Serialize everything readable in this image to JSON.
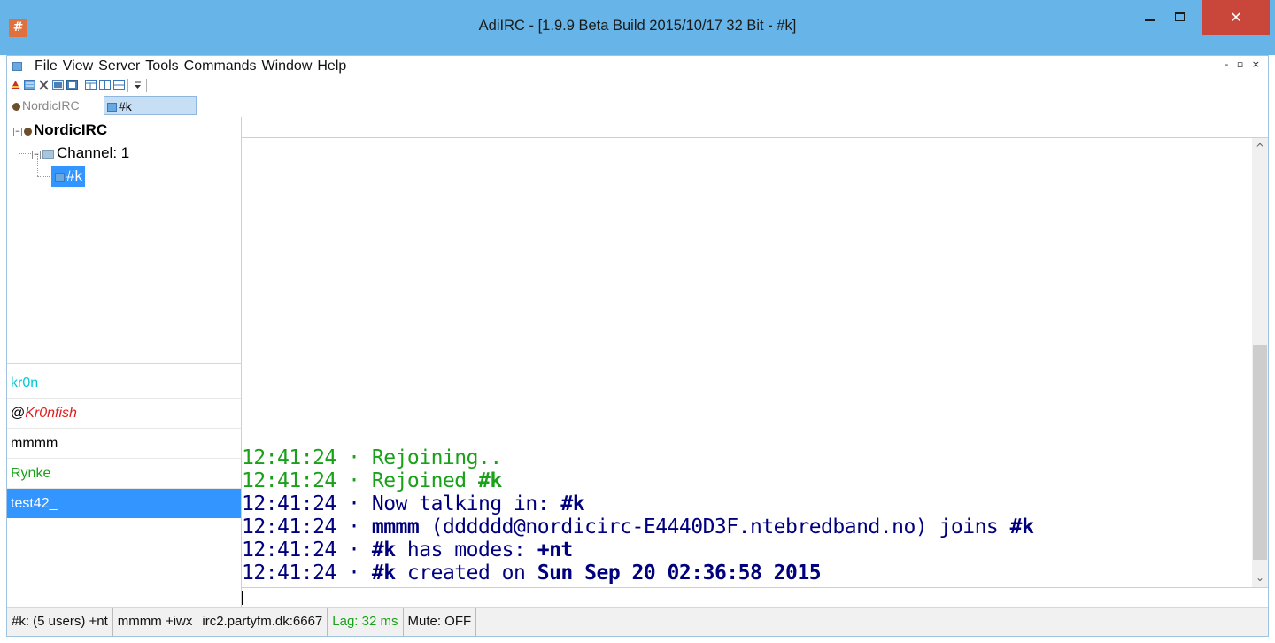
{
  "window": {
    "title": "AdiIRC - [1.9.9 Beta Build 2015/10/17 32 Bit - #k]",
    "app_icon": "#",
    "close_glyph": "✕",
    "mdi_controls": "- ▫ ×"
  },
  "menu": {
    "items": [
      "File",
      "View",
      "Server",
      "Tools",
      "Commands",
      "Window",
      "Help"
    ]
  },
  "tabs": {
    "server": "NordicIRC",
    "channel": "#k"
  },
  "tree": {
    "network": "NordicIRC",
    "group": "Channel: 1",
    "channel": "#k"
  },
  "nicks": [
    {
      "prefix": "",
      "name": "kr0n",
      "color": "#00c8d8"
    },
    {
      "prefix": "@",
      "name": "Kr0nfish",
      "color": "#e02020"
    },
    {
      "prefix": "",
      "name": "mmmm",
      "color": "#000000"
    },
    {
      "prefix": "",
      "name": "Rynke",
      "color": "#1aa11a"
    },
    {
      "prefix": "",
      "name": "test42_",
      "color": "#ffffff"
    }
  ],
  "chat": {
    "lines": [
      {
        "time": "12:41:24",
        "sep": "·",
        "parts": [
          {
            "t": " Rejoining..",
            "c": "green"
          }
        ]
      },
      {
        "time": "12:41:24",
        "sep": "·",
        "parts": [
          {
            "t": " Rejoined ",
            "c": "green"
          },
          {
            "t": "#k",
            "c": "green",
            "b": true
          }
        ]
      },
      {
        "time": "12:41:24",
        "sep": "·",
        "parts": [
          {
            "t": " Now talking in: ",
            "c": "navy"
          },
          {
            "t": "#k",
            "c": "navy",
            "b": true
          }
        ]
      },
      {
        "time": "12:41:24",
        "sep": "·",
        "parts": [
          {
            "t": " ",
            "c": "navy"
          },
          {
            "t": "mmmm",
            "c": "navy",
            "b": true
          },
          {
            "t": " (dddddd@nordicirc-E4440D3F.ntebredband.no) joins ",
            "c": "navy"
          },
          {
            "t": "#k",
            "c": "navy",
            "b": true
          }
        ]
      },
      {
        "time": "12:41:24",
        "sep": "·",
        "parts": [
          {
            "t": " ",
            "c": "navy"
          },
          {
            "t": "#k",
            "c": "navy",
            "b": true
          },
          {
            "t": " has modes: ",
            "c": "navy"
          },
          {
            "t": "+nt",
            "c": "navy",
            "b": true
          }
        ]
      },
      {
        "time": "12:41:24",
        "sep": "·",
        "parts": [
          {
            "t": " ",
            "c": "navy"
          },
          {
            "t": "#k",
            "c": "navy",
            "b": true
          },
          {
            "t": " created on ",
            "c": "navy"
          },
          {
            "t": "Sun Sep 20 02:36:58 2015",
            "c": "navy",
            "b": true
          }
        ]
      }
    ]
  },
  "scrollbar": {
    "up_glyph": "^",
    "down_glyph": "⌄"
  },
  "status": {
    "channel": "#k: (5 users) +nt",
    "nick": "mmmm +iwx",
    "server": "irc2.partyfm.dk:6667",
    "lag": "Lag: 32 ms",
    "mute": "Mute: OFF"
  },
  "colors": {
    "titlebar": "#66b4e8",
    "selection": "#3395ff",
    "close": "#c9473a",
    "chat_green": "#1aa11a",
    "chat_navy": "#00007f"
  }
}
